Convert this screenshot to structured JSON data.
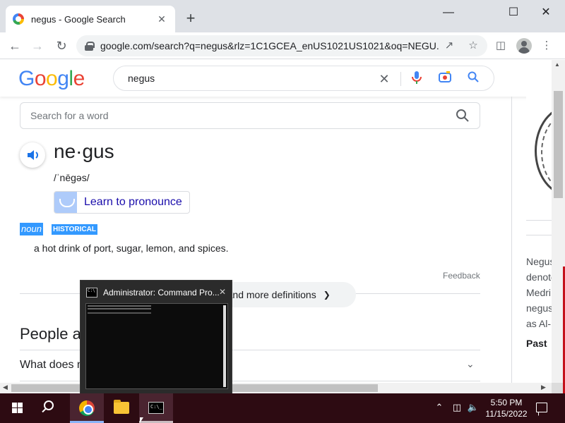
{
  "browser": {
    "tab_title": "negus - Google Search",
    "tab_close": "✕",
    "new_tab": "+",
    "minimize": "—",
    "maximize": "☐",
    "close": "✕",
    "url": "google.com/search?q=negus&rlz=1C1GCEA_enUS1021US1021&oq=NEGU..."
  },
  "google": {
    "logo": [
      "G",
      "o",
      "o",
      "g",
      "l",
      "e"
    ],
    "query": "negus"
  },
  "dictionary": {
    "search_placeholder": "Search for a word",
    "headword": "ne·gus",
    "phonetic": "/ˈnēɡəs/",
    "pronounce_label": "Learn to pronounce",
    "part_of_speech": "noun",
    "register": "HISTORICAL",
    "definition": "a hot drink of port, sugar, lemon, and spices.",
    "feedback": "Feedback",
    "more_definitions": "Translations and more definitions"
  },
  "people_also_ask": {
    "heading": "People also ask",
    "questions": [
      "What does negus mean?"
    ]
  },
  "knowledge_panel": {
    "snippet_lines": [
      "Negus",
      "denotes",
      "Medri",
      "negus",
      "as Al-"
    ],
    "section_heading": "Past"
  },
  "thumbnail": {
    "title": "Administrator: Command Pro...",
    "close": "✕"
  },
  "taskbar": {
    "time": "5:50 PM",
    "date": "11/15/2022"
  },
  "colors": {
    "accent_blue": "#4285f4",
    "selection_blue": "#3399ff",
    "taskbar": "#2d0b12"
  }
}
